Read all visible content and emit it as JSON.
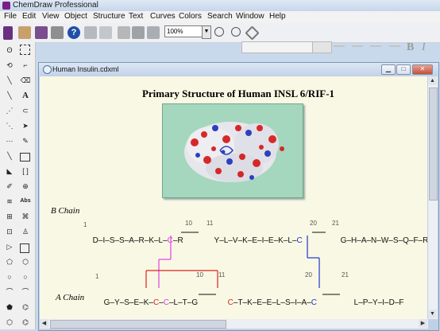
{
  "app": {
    "title": "ChemDraw Professional"
  },
  "menu": [
    "File",
    "Edit",
    "View",
    "Object",
    "Structure",
    "Text",
    "Curves",
    "Colors",
    "Search",
    "Window",
    "Help"
  ],
  "toolbar": {
    "zoom": "100%"
  },
  "document": {
    "window_title": "Human Insulin.cdxml",
    "heading": "Primary Structure of Human INSL 6/RIF-1",
    "b_chain_label": "B Chain",
    "a_chain_label": "A Chain",
    "b_chain": {
      "residues": [
        "D",
        "I",
        "S",
        "S",
        "A",
        "R",
        "K",
        "L",
        "C",
        "R",
        "Y",
        "L",
        "V",
        "K",
        "E",
        "I",
        "E",
        "K",
        "L",
        "C",
        "G",
        "H",
        "A",
        "N",
        "W",
        "S",
        "Q",
        "F",
        "R"
      ],
      "numbers": {
        "n1": "1",
        "n10": "10",
        "n11": "11",
        "n20": "20",
        "n21": "21"
      }
    },
    "a_chain": {
      "residues": [
        "G",
        "Y",
        "S",
        "E",
        "K",
        "C",
        "C",
        "L",
        "T",
        "G",
        "C",
        "T",
        "K",
        "E",
        "E",
        "L",
        "S",
        "I",
        "A",
        "C",
        "L",
        "P",
        "Y",
        "I",
        "D",
        "F"
      ],
      "numbers": {
        "n1": "1",
        "n10": "10",
        "n11": "11",
        "n20": "20",
        "n21": "21"
      }
    }
  },
  "colors": {
    "cys_pink": "#e040e0",
    "cys_red": "#dd2222",
    "cys_blue": "#2233cc",
    "canvas_bg": "#f9f8e4",
    "protein_bg": "#a4d7bd"
  }
}
